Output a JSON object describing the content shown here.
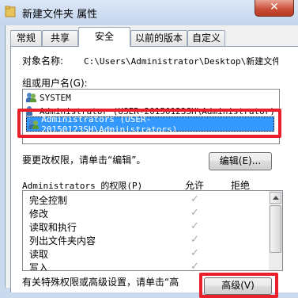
{
  "window": {
    "title": "新建文件夹 属性",
    "close_label": "✕"
  },
  "tabs": [
    {
      "label": "常规"
    },
    {
      "label": "共享"
    },
    {
      "label": "安全"
    },
    {
      "label": "以前的版本"
    },
    {
      "label": "自定义"
    }
  ],
  "security": {
    "object_name_label": "对象名称:",
    "object_name_value": "C:\\Users\\Administrator\\Desktop\\新建文件夹",
    "group_label": "组或用户名(G):",
    "users": [
      {
        "name": "SYSTEM"
      },
      {
        "name": "Administrator (USER-20150123SH\\Administrator)"
      },
      {
        "name": "Administrators (USER-20150123SH\\Administrators)"
      }
    ],
    "change_hint": "要更改权限，请单击“编辑”。",
    "edit_button": "编辑(E)...",
    "perm_header": "Administrators 的权限(P)",
    "allow_label": "允许",
    "deny_label": "拒绝",
    "permissions": [
      {
        "name": "完全控制"
      },
      {
        "name": "修改"
      },
      {
        "name": "读取和执行"
      },
      {
        "name": "列出文件夹内容"
      },
      {
        "name": "读取"
      },
      {
        "name": "写入"
      }
    ],
    "check_mark": "✓",
    "special_hint": "有关特殊权限或高级设置，请单击“高",
    "advanced_button": "高级(V)"
  },
  "colors": {
    "selection": "#3399ff",
    "highlight_box": "#e8202a"
  }
}
